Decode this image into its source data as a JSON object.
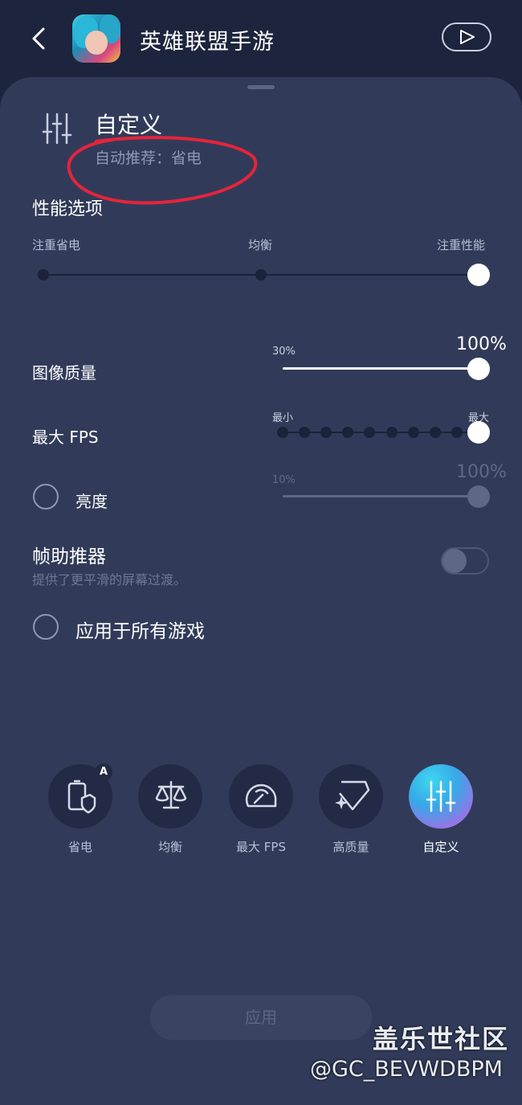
{
  "header": {
    "title": "英雄联盟手游"
  },
  "current_mode": {
    "name": "自定义",
    "recommendation": "自动推荐：省电"
  },
  "performance": {
    "label": "性能选项",
    "ticks": [
      "注重省电",
      "均衡",
      "注重性能"
    ],
    "selected_index": 2
  },
  "image_quality": {
    "label": "图像质量",
    "min_label": "30%",
    "value_label": "100%",
    "value": 1.0
  },
  "max_fps": {
    "label": "最大 FPS",
    "min_label": "最小",
    "max_label": "最大",
    "steps": 10,
    "selected_step": 9
  },
  "brightness": {
    "label": "亮度",
    "checked": false,
    "min_label": "10%",
    "value_label": "100%",
    "value": 1.0
  },
  "frame_booster": {
    "label": "帧助推器",
    "description": "提供了更平滑的屏幕过渡。",
    "enabled": false
  },
  "apply_all": {
    "label": "应用于所有游戏",
    "checked": false
  },
  "modes": [
    {
      "label": "省电",
      "icon": "battery-shield-icon",
      "badge": "A"
    },
    {
      "label": "均衡",
      "icon": "scale-icon"
    },
    {
      "label": "最大 FPS",
      "icon": "speedometer-icon"
    },
    {
      "label": "高质量",
      "icon": "diamond-icon"
    },
    {
      "label": "自定义",
      "icon": "sliders-icon",
      "active": true
    }
  ],
  "apply_button": "应用",
  "watermark": {
    "line1": "盖乐世社区",
    "line2": "@GC_BEVWDBPM"
  },
  "colors": {
    "background": "#1d243d",
    "panel": "#313b59",
    "annotation": "#e5243b"
  }
}
